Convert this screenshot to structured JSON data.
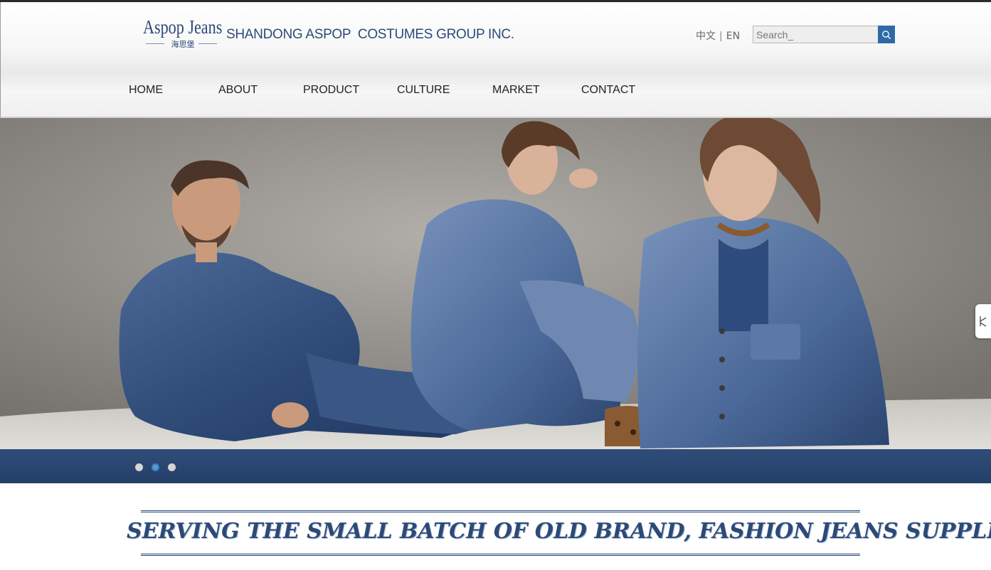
{
  "logo": {
    "brand": "Aspop Jeans",
    "brand_cn": "海思堡"
  },
  "header": {
    "company_name": "SHANDONG ASPOP  COSTUMES GROUP INC.",
    "lang_cn": "中文",
    "lang_sep": "|",
    "lang_en": "EN",
    "search_placeholder": "Search_"
  },
  "nav": {
    "items": [
      {
        "label": "HOME"
      },
      {
        "label": "ABOUT"
      },
      {
        "label": "PRODUCT"
      },
      {
        "label": "CULTURE"
      },
      {
        "label": "MARKET"
      },
      {
        "label": "CONTACT"
      }
    ]
  },
  "slider": {
    "dot_count": 3,
    "active_dot_index": 1
  },
  "tagline": "SERVING THE SMALL BATCH OF OLD BRAND, FASHION JEANS SUPPLIER",
  "colors": {
    "brand_navy": "#2c4a78",
    "search_button": "#2f6aa6",
    "slider_bar": "#2f4d7a",
    "active_dot": "#5a9bd6"
  },
  "icons": {
    "search": "search-icon",
    "side_tab": "bookmark-icon"
  }
}
